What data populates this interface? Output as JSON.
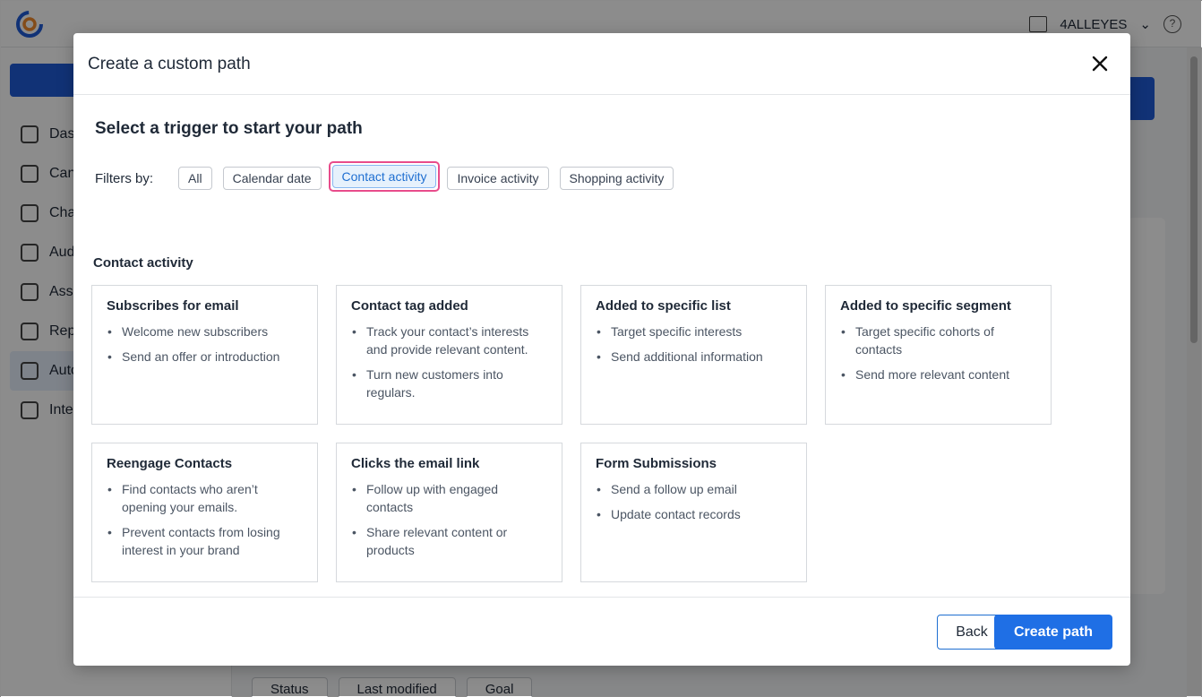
{
  "app": {
    "account_name": "4ALLEYES",
    "nav_items": [
      {
        "label": "Das",
        "icon": "dashboard-icon"
      },
      {
        "label": "Can",
        "icon": "target-icon"
      },
      {
        "label": "Cha",
        "icon": "send-icon"
      },
      {
        "label": "Aud",
        "icon": "users-icon"
      },
      {
        "label": "Asse",
        "icon": "palette-icon"
      },
      {
        "label": "Rep",
        "icon": "chart-icon"
      },
      {
        "label": "Auto",
        "icon": "arrow-icon"
      },
      {
        "label": "Inte",
        "icon": "wrench-icon"
      }
    ],
    "bottom_filters": [
      "Status",
      "Last modified",
      "Goal"
    ]
  },
  "modal": {
    "title": "Create a custom path",
    "close_icon": "close-icon",
    "heading": "Select a trigger to start your path",
    "filters_label": "Filters by:",
    "filters": [
      "All",
      "Calendar date",
      "Contact activity",
      "Invoice activity",
      "Shopping activity"
    ],
    "selected_filter": "Contact activity",
    "section_label": "Contact activity",
    "cards": [
      {
        "title": "Subscribes for email",
        "bullets": [
          "Welcome new subscribers",
          "Send an offer or introduction"
        ]
      },
      {
        "title": "Contact tag added",
        "bullets": [
          "Track your contact’s interests and provide relevant content.",
          "Turn new customers into regulars."
        ]
      },
      {
        "title": "Added to specific list",
        "bullets": [
          "Target specific interests",
          "Send additional information"
        ]
      },
      {
        "title": "Added to specific segment",
        "bullets": [
          "Target specific cohorts of contacts",
          "Send more relevant content"
        ]
      },
      {
        "title": "Reengage Contacts",
        "bullets": [
          "Find contacts who aren’t opening your emails.",
          "Prevent contacts from losing interest in your brand"
        ]
      },
      {
        "title": "Clicks the email link",
        "bullets": [
          "Follow up with engaged contacts",
          "Share relevant content or products"
        ]
      },
      {
        "title": "Form Submissions",
        "bullets": [
          "Send a follow up email",
          "Update contact records"
        ]
      }
    ],
    "back_label": "Back",
    "create_label": "Create path"
  },
  "colors": {
    "primary": "#1f6fe5",
    "highlight": "#e84c8b",
    "selected_chip_bg": "#e6f1fc"
  }
}
